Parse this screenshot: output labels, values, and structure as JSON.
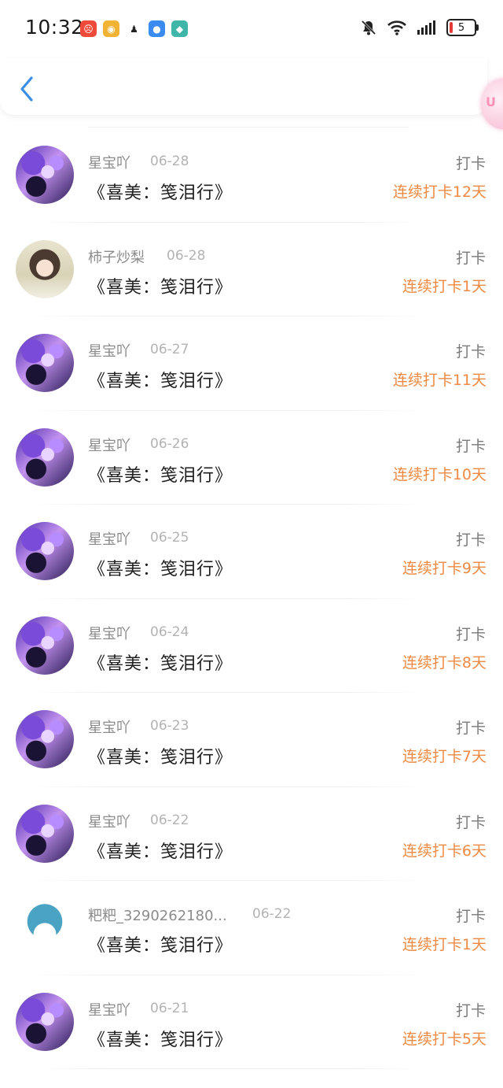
{
  "status_bar": {
    "time": "10:32",
    "battery": "5",
    "app_icons": [
      {
        "icon": "red-app-icon",
        "color": "#f04b3a"
      },
      {
        "icon": "weibo-icon",
        "color": "#f2b233"
      },
      {
        "icon": "qq-penguin-icon",
        "color": "#222222"
      },
      {
        "icon": "message-bubble-icon",
        "color": "#3a8cf0"
      },
      {
        "icon": "shield-app-icon",
        "color": "#3fb6a8"
      }
    ],
    "system_icons": [
      "bell-muted-icon",
      "wifi-icon",
      "signal-icon",
      "battery-icon"
    ]
  },
  "header": {
    "back_icon": "chevron-left-icon",
    "accent": "#3a8ee6"
  },
  "entries": [
    {
      "user": "星宝吖",
      "date": "06-28",
      "title": "《喜美：笺泪行》",
      "type": "打卡",
      "streak": "连续打卡12天",
      "avatar": "purple"
    },
    {
      "user": "柿子炒梨",
      "date": "06-28",
      "title": "《喜美：笺泪行》",
      "type": "打卡",
      "streak": "连续打卡1天",
      "avatar": "girl"
    },
    {
      "user": "星宝吖",
      "date": "06-27",
      "title": "《喜美：笺泪行》",
      "type": "打卡",
      "streak": "连续打卡11天",
      "avatar": "purple"
    },
    {
      "user": "星宝吖",
      "date": "06-26",
      "title": "《喜美：笺泪行》",
      "type": "打卡",
      "streak": "连续打卡10天",
      "avatar": "purple"
    },
    {
      "user": "星宝吖",
      "date": "06-25",
      "title": "《喜美：笺泪行》",
      "type": "打卡",
      "streak": "连续打卡9天",
      "avatar": "purple"
    },
    {
      "user": "星宝吖",
      "date": "06-24",
      "title": "《喜美：笺泪行》",
      "type": "打卡",
      "streak": "连续打卡8天",
      "avatar": "purple"
    },
    {
      "user": "星宝吖",
      "date": "06-23",
      "title": "《喜美：笺泪行》",
      "type": "打卡",
      "streak": "连续打卡7天",
      "avatar": "purple"
    },
    {
      "user": "星宝吖",
      "date": "06-22",
      "title": "《喜美：笺泪行》",
      "type": "打卡",
      "streak": "连续打卡6天",
      "avatar": "purple"
    },
    {
      "user": "粑粑_3290262180...",
      "date": "06-22",
      "title": "《喜美：笺泪行》",
      "type": "打卡",
      "streak": "连续打卡1天",
      "avatar": "cartoon"
    },
    {
      "user": "星宝吖",
      "date": "06-21",
      "title": "《喜美：笺泪行》",
      "type": "打卡",
      "streak": "连续打卡5天",
      "avatar": "purple"
    }
  ],
  "colors": {
    "streak": "#ee8a43",
    "name": "#8c8c8c",
    "date": "#b3b3b3"
  }
}
